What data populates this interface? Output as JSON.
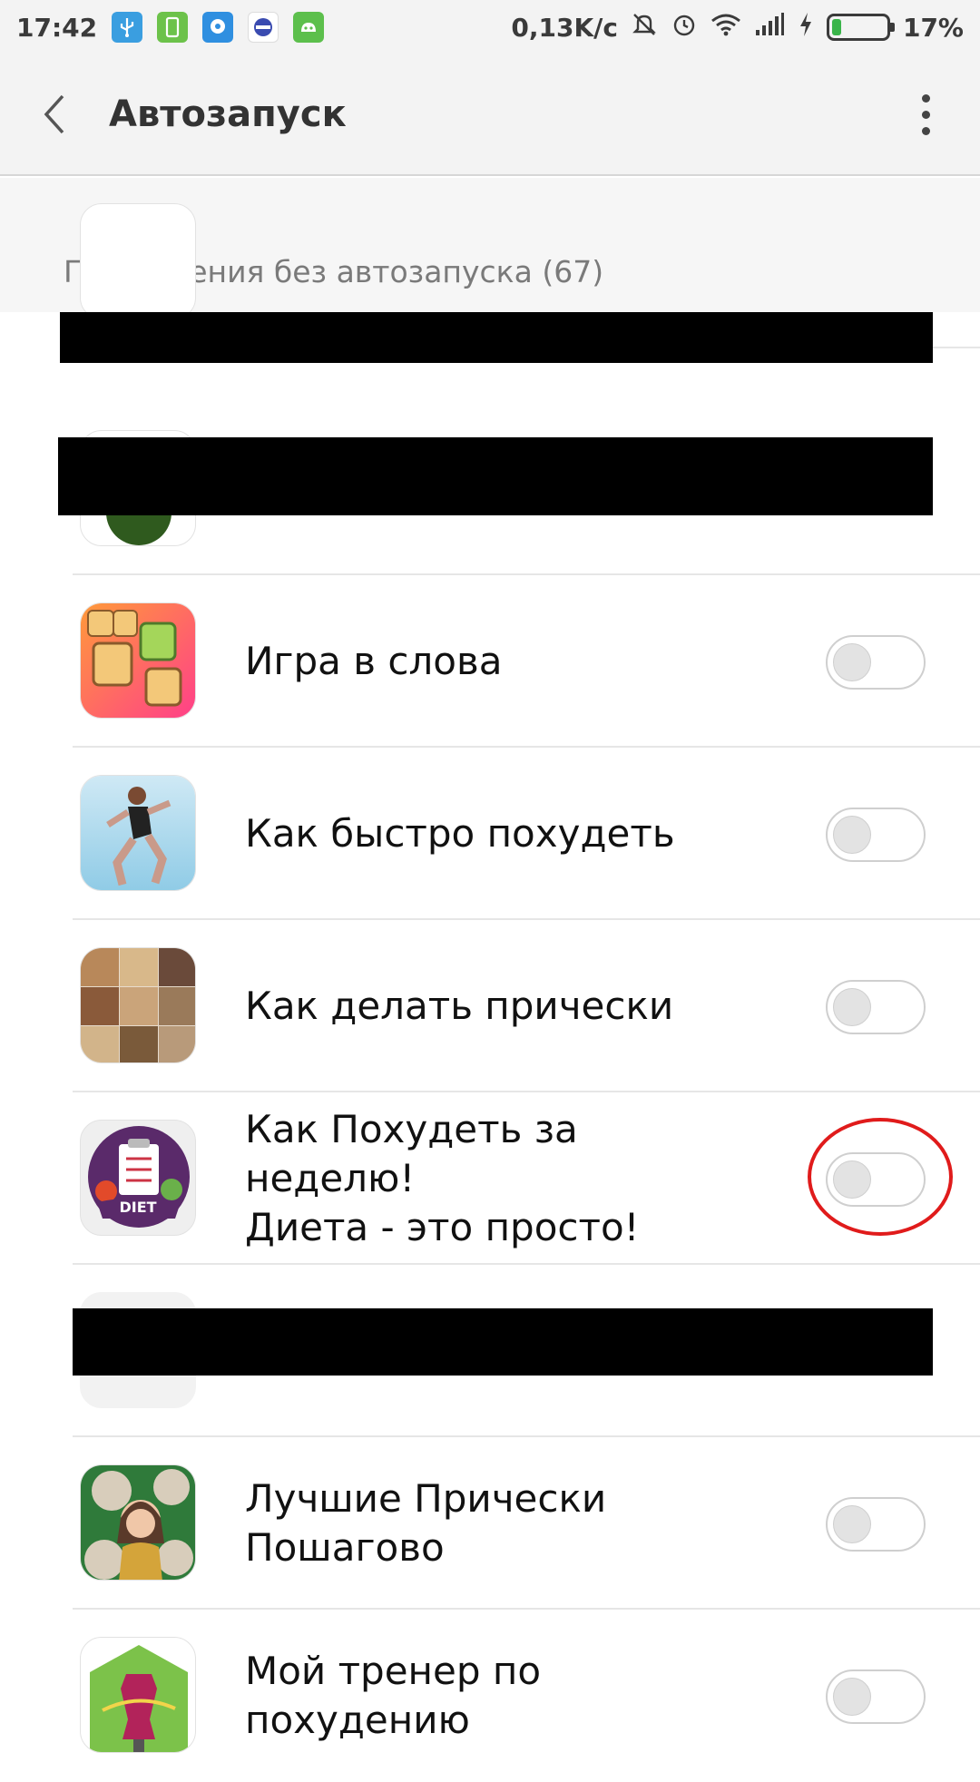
{
  "status_bar": {
    "time": "17:42",
    "speed": "0,13K/c",
    "battery": "17%",
    "notification_icons": [
      "usb-icon",
      "phone-icon",
      "chat-icon",
      "browser-icon",
      "android-icon"
    ],
    "system_icons": [
      "mute-icon",
      "alarm-icon",
      "wifi-icon",
      "signal-icon",
      "charging-icon",
      "battery-icon"
    ]
  },
  "toolbar": {
    "title": "Автозапуск",
    "back_icon": "chevron-left-icon",
    "menu_icon": "more-vert-icon"
  },
  "section": {
    "title": "Приложения без автозапуска (67)"
  },
  "apps": [
    {
      "label": "",
      "redacted": true
    },
    {
      "label": "",
      "redacted": true
    },
    {
      "label": "Игра в слова",
      "enabled": false
    },
    {
      "label": "Как быстро похудеть",
      "enabled": false
    },
    {
      "label": "Как делать прически",
      "enabled": false
    },
    {
      "label": "Как Похудеть за неделю!\nДиета - это просто!",
      "enabled": false,
      "icon_text": "DIET"
    },
    {
      "label": "",
      "redacted": true
    },
    {
      "label": "Лучшие Прически\nПошагово",
      "enabled": false
    },
    {
      "label": "Мой тренер по похудению",
      "enabled": false
    }
  ],
  "colors": {
    "accent_highlight": "#e01b1b",
    "battery_fill": "#3ab54a"
  }
}
